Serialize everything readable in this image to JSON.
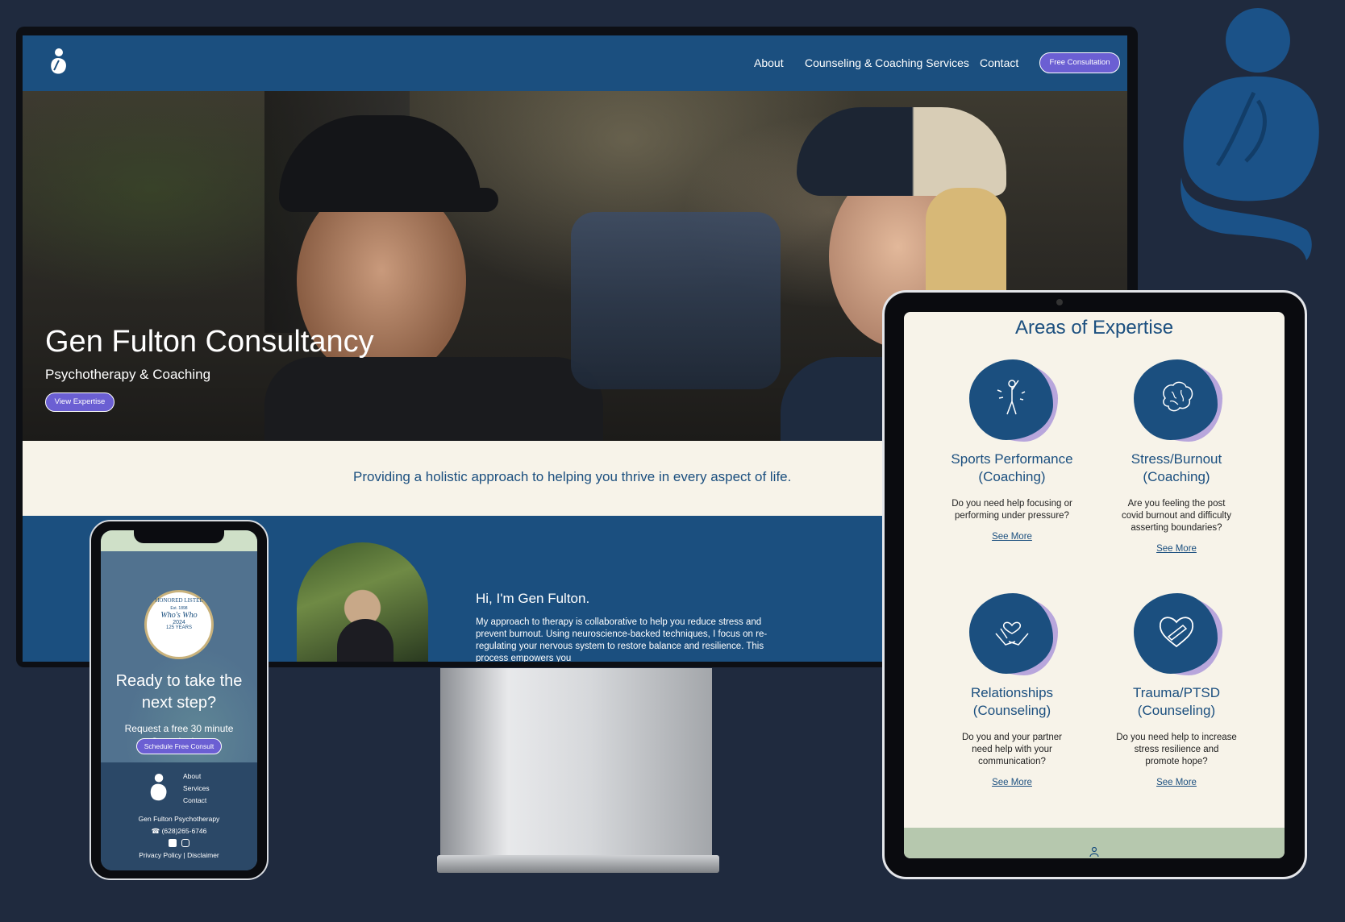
{
  "desktop": {
    "nav": {
      "items": [
        "About",
        "Counseling & Coaching Services",
        "Contact"
      ],
      "cta": "Free Consultation"
    },
    "hero": {
      "title": "Gen Fulton Consultancy",
      "subtitle": "Psychotherapy & Coaching",
      "button": "View Expertise"
    },
    "tagline": "Providing a holistic approach to helping you thrive in every aspect of life.",
    "about": {
      "heading": "Hi, I'm Gen Fulton.",
      "body": "My approach to therapy is collaborative to help you reduce stress and prevent burnout. Using neuroscience-backed techniques, I focus on re-regulating your nervous system to restore balance and resilience. This process empowers you"
    }
  },
  "phone": {
    "seal": {
      "top": "HONORED LISTEE",
      "year": "2024",
      "est": "Est. 1898",
      "brand": "Who's Who",
      "years": "125 YEARS"
    },
    "heading": "Ready to take the next step?",
    "subtext": "Request a free 30 minute Consultation.",
    "button": "Schedule Free Consult",
    "footer": {
      "links": [
        "About",
        "Services",
        "Contact"
      ],
      "name": "Gen Fulton Psychotherapy",
      "phone": "(628)265-6746",
      "legal": [
        "Privacy Policy",
        "|",
        "Disclaimer"
      ]
    }
  },
  "tablet": {
    "title": "Areas of Expertise",
    "cards": [
      {
        "title": "Sports Performance",
        "sub": "(Coaching)",
        "desc": "Do you need help focusing or performing under pressure?",
        "link": "See More",
        "icon": "athlete-icon"
      },
      {
        "title": "Stress/Burnout",
        "sub": "(Coaching)",
        "desc": "Are you feeling the post covid burnout and difficulty asserting boundaries?",
        "link": "See More",
        "icon": "brain-icon"
      },
      {
        "title": "Relationships",
        "sub": "(Counseling)",
        "desc": "Do you and your partner need help with your communication?",
        "link": "See More",
        "icon": "hands-heart-icon"
      },
      {
        "title": "Trauma/PTSD",
        "sub": "(Counseling)",
        "desc": "Do you need help to increase stress resilience and promote hope?",
        "link": "See More",
        "icon": "bandaged-heart-icon"
      }
    ]
  },
  "colors": {
    "brand": "#1b4f7f",
    "accent": "#6b5fd3",
    "background": "#1f2a3e",
    "cream": "#f7f3e9",
    "blob": "#b8a6dc"
  }
}
